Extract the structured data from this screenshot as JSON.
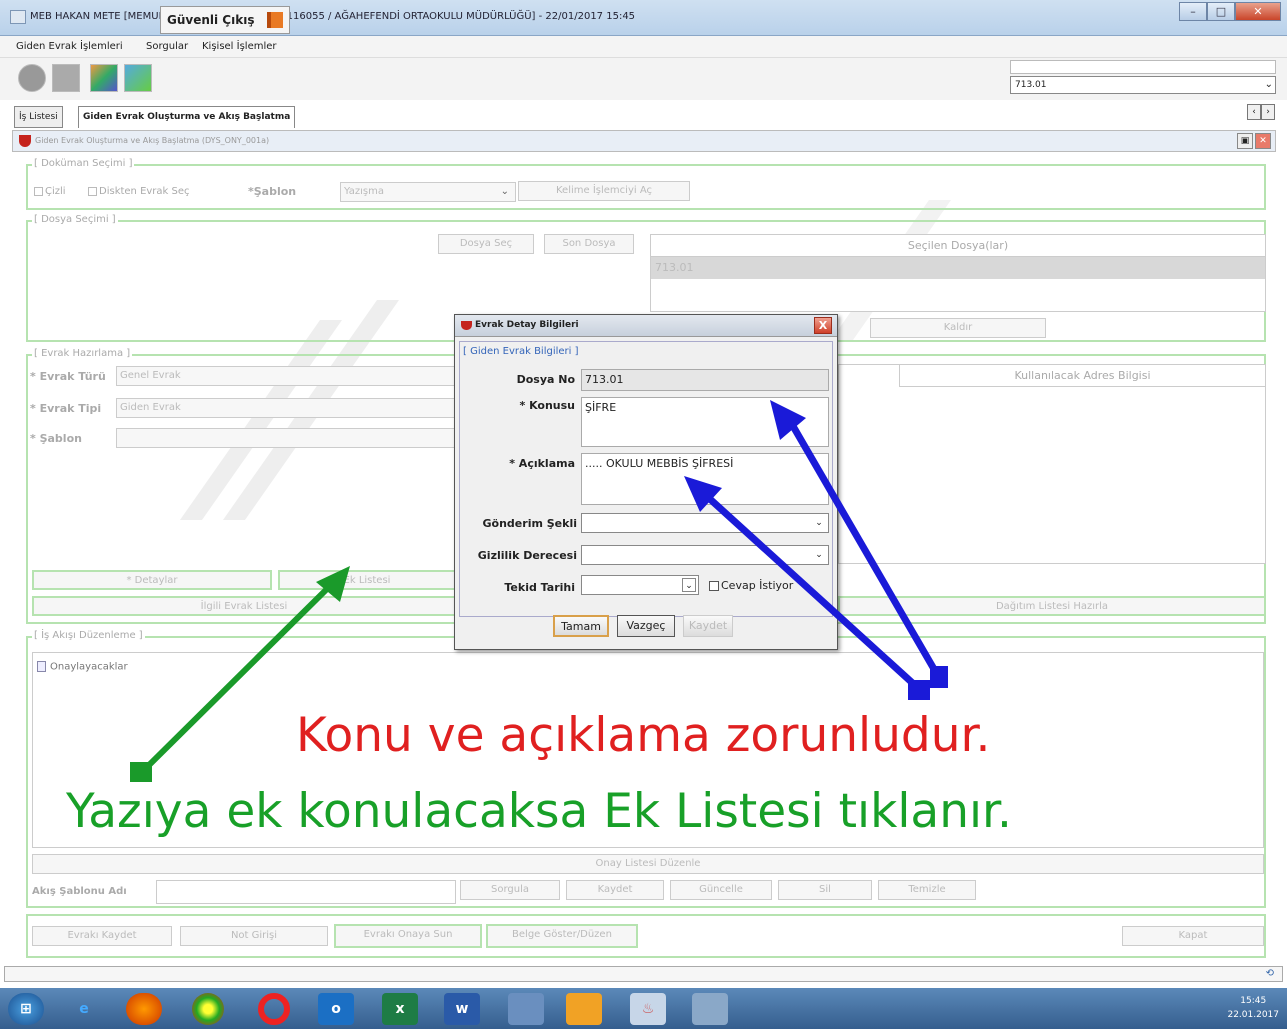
{
  "window": {
    "title": "MEB HAKAN METE [MEMUR] - GorevId:1158509 - [1116055 / AĞAHEFENDİ ORTAOKULU MÜDÜRLÜĞÜ] - 22/01/2017 15:45"
  },
  "menu": [
    "Giden Evrak İşlemleri",
    "Sorgular",
    "Kişisel İşlemler"
  ],
  "toolbar": {
    "exit_label": "Güvenli Çıkış",
    "code_select": "713.01"
  },
  "tabs": [
    "İş Listesi",
    "Giden Evrak Oluşturma ve Akış Başlatma"
  ],
  "panel": {
    "title": "Giden Evrak Oluşturma ve Akış Başlatma (DYS_ONY_001a)",
    "dokuman": {
      "legend": "[ Doküman Seçimi ]",
      "cizli": "Çizli",
      "disk_check": "Diskten Evrak Seç",
      "sablon_label": "*Şablon",
      "sablon_value": "Yazışma",
      "kelime_btn": "Kelime İşlemciyi Aç"
    },
    "dosya": {
      "legend": "[ Dosya Seçimi ]",
      "dosya_sec": "Dosya Seç",
      "son_dosya": "Son Dosya",
      "secilen_header": "Seçilen Dosya(lar)",
      "secilen_value": "713.01",
      "kaldir": "Kaldır"
    },
    "evrak": {
      "legend": "[ Evrak Hazırlama ]",
      "turu_label": "* Evrak Türü",
      "turu_value": "Genel Evrak",
      "tipi_label": "* Evrak Tipi",
      "tipi_value": "Giden Evrak",
      "sablon_label": "* Şablon",
      "adres_header": "Kullanılacak Adres Bilgisi",
      "detaylar": "* Detaylar",
      "ek_listesi": "Ek Listesi",
      "ilgili": "İlgili Evrak Listesi",
      "dagitim": "Dağıtım Listesi Hazırla"
    },
    "akis": {
      "legend": "[ İş Akışı Düzenleme ]",
      "tree_item": "Onaylayacaklar",
      "onay_listesi": "Onay Listesi Düzenle",
      "sablon_adi_label": "Akış Şablonu Adı",
      "sorgula": "Sorgula",
      "kaydet": "Kaydet",
      "guncelle": "Güncelle",
      "sil": "Sil",
      "temizle": "Temizle"
    },
    "footer": {
      "evraki_kaydet": "Evrakı Kaydet",
      "not_girisi": "Not Girişi",
      "onaya_sun": "Evrakı Onaya Sun",
      "belge_goster": "Belge Göster/Düzen",
      "kapat": "Kapat"
    }
  },
  "dialog": {
    "title": "Evrak Detay Bilgileri",
    "close": "X",
    "legend": "[ Giden Evrak Bilgileri ]",
    "dosya_no_label": "Dosya No",
    "dosya_no_value": "713.01",
    "konusu_label": "* Konusu",
    "konusu_value": "ŞİFRE",
    "aciklama_label": "* Açıklama",
    "aciklama_value": "..... OKULU MEBBİS ŞİFRESİ",
    "gonderim_label": "Gönderim Şekli",
    "gizlilik_label": "Gizlilik Derecesi",
    "tekid_label": "Tekid Tarihi",
    "cevap_label": "Cevap İstiyor",
    "tamam": "Tamam",
    "vazgec": "Vazgeç",
    "kaydet": "Kaydet"
  },
  "annotations": {
    "red_text": "Konu ve açıklama zorunludur.",
    "green_text": "Yazıya ek konulacaksa Ek Listesi tıklanır.",
    "red_color": "#e02020",
    "green_color": "#18a028",
    "arrow_blue": "#1a1ad8",
    "arrow_green": "#1a9a2a"
  },
  "taskbar": {
    "time": "15:45",
    "date": "22.01.2017"
  }
}
